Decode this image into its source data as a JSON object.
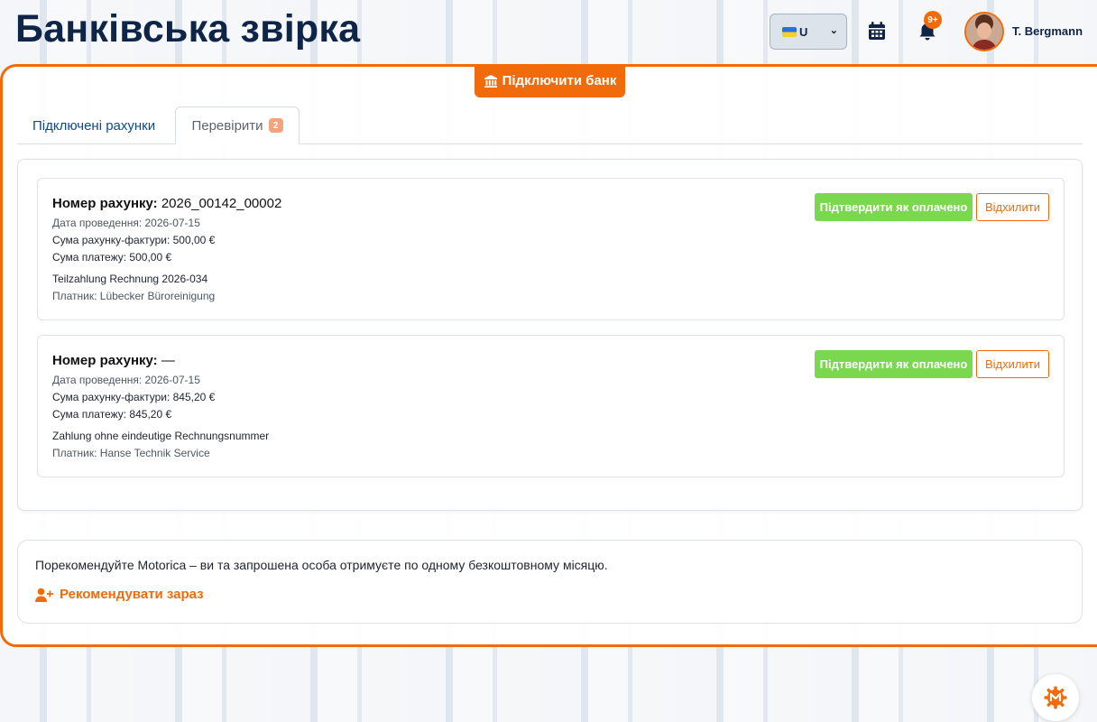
{
  "header": {
    "title": "Банківська звірка",
    "language": {
      "flag": "ukraine-flag",
      "code": "U"
    },
    "notifications_count": "9+",
    "user_name": "T. Bergmann"
  },
  "actions": {
    "connect_bank": "Підключити банк"
  },
  "tabs": [
    {
      "label": "Підключені рахунки",
      "active": false
    },
    {
      "label": "Перевірити",
      "count": "2",
      "active": true
    }
  ],
  "transactions": [
    {
      "invoice_label": "Номер рахунку:",
      "invoice_number": "2026_00142_00002",
      "booking_date": "Дата проведення: 2026-07-15",
      "invoice_amount": "Сума рахунку-фактури: 500,00 €",
      "payment_amount": "Сума платежу: 500,00 €",
      "reference": "Teilzahlung Rechnung 2026-034",
      "payer": "Платник: Lübecker Büroreinigung",
      "confirm_label": "Підтвердити як оплачено",
      "reject_label": "Відхилити"
    },
    {
      "invoice_label": "Номер рахунку:",
      "invoice_number": "—",
      "booking_date": "Дата проведення: 2026-07-15",
      "invoice_amount": "Сума рахунку-фактури: 845,20 €",
      "payment_amount": "Сума платежу: 845,20 €",
      "reference": "Zahlung ohne eindeutige Rechnungsnummer",
      "payer": "Платник: Hanse Technik Service",
      "confirm_label": "Підтвердити як оплачено",
      "reject_label": "Відхилити"
    }
  ],
  "referral": {
    "text": "Порекомендуйте Motorica – ви та запрошена особа отримуєте по одному безкоштовному місяцю.",
    "link": "Рекомендувати зараз"
  },
  "colors": {
    "accent": "#f26b0a",
    "confirm": "#7ad84f",
    "title": "#0f2547"
  }
}
